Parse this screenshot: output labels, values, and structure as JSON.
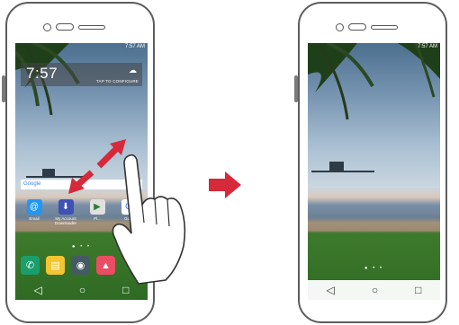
{
  "left_phone": {
    "status_bar": {
      "time": "7:57 AM"
    },
    "clock_widget": {
      "time": "7:57",
      "weather_icon": "cloud-icon",
      "configure_label": "TAP TO CONFIGURE"
    },
    "search_bar": {
      "label": "Google"
    },
    "apps": [
      {
        "label": "Email",
        "icon": "at-sign-icon",
        "color": "#2196f3"
      },
      {
        "label": "My Account Downloader",
        "icon": "user-download-icon",
        "color": "#3f51b5"
      },
      {
        "label": "Pl...",
        "icon": "play-store-icon",
        "color": "#e0e0e0"
      },
      {
        "label": "Go...",
        "icon": "google-icon",
        "color": "#ffffff"
      }
    ],
    "page_dots": "● • •",
    "dock": [
      {
        "icon": "phone-icon",
        "color": "#1a9e6b"
      },
      {
        "icon": "messages-icon",
        "color": "#f3c530"
      },
      {
        "icon": "camera-icon",
        "color": "#455a64"
      },
      {
        "icon": "gallery-icon",
        "color": "#e84d63"
      }
    ],
    "nav": {
      "back": "◁",
      "home": "○",
      "recents": "□"
    }
  },
  "right_phone": {
    "status_bar": {
      "time": "7:57 AM"
    },
    "page_dots": "● • •",
    "nav": {
      "back": "◁",
      "home": "○",
      "recents": "□"
    }
  },
  "colors": {
    "gesture_arrow": "#d6293a",
    "transition_arrow": "#d6293a"
  }
}
